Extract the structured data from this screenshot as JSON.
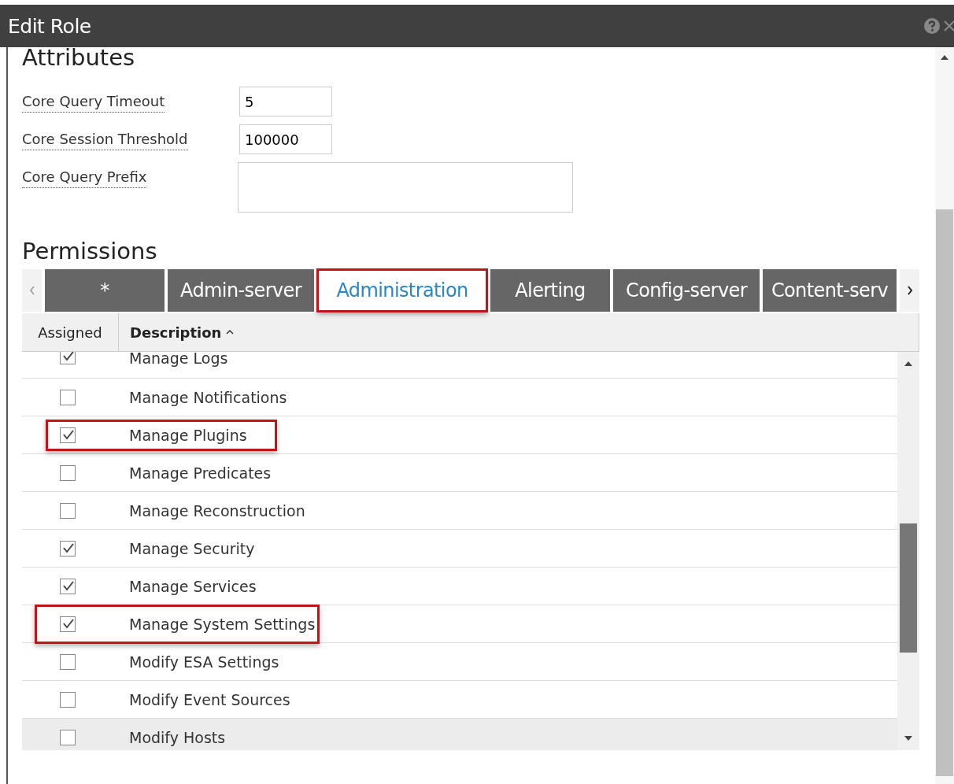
{
  "window": {
    "title": "Edit Role"
  },
  "attributes": {
    "heading": "Attributes",
    "fields": [
      {
        "label": "Core Query Timeout",
        "value": "5",
        "kind": "short"
      },
      {
        "label": "Core Session Threshold",
        "value": "100000",
        "kind": "short"
      },
      {
        "label": "Core Query Prefix",
        "kind": "area"
      }
    ]
  },
  "permissions": {
    "heading": "Permissions",
    "tabs": [
      {
        "label": "*",
        "selected": false,
        "highlighted": false
      },
      {
        "label": "Admin-server",
        "selected": false,
        "highlighted": false
      },
      {
        "label": "Administration",
        "selected": true,
        "highlighted": true
      },
      {
        "label": "Alerting",
        "selected": false,
        "highlighted": false
      },
      {
        "label": "Config-server",
        "selected": false,
        "highlighted": false
      },
      {
        "label": "Content-serv",
        "selected": false,
        "highlighted": false
      }
    ],
    "columns": [
      "Assigned",
      "Description"
    ],
    "rows": [
      {
        "description": "Manage Logs",
        "checked": true,
        "highlighted": false,
        "hovered": false
      },
      {
        "description": "Manage Notifications",
        "checked": false,
        "highlighted": false,
        "hovered": false
      },
      {
        "description": "Manage Plugins",
        "checked": true,
        "highlighted": true,
        "hovered": false
      },
      {
        "description": "Manage Predicates",
        "checked": false,
        "highlighted": false,
        "hovered": false
      },
      {
        "description": "Manage Reconstruction",
        "checked": false,
        "highlighted": false,
        "hovered": false
      },
      {
        "description": "Manage Security",
        "checked": true,
        "highlighted": false,
        "hovered": false
      },
      {
        "description": "Manage Services",
        "checked": true,
        "highlighted": false,
        "hovered": false
      },
      {
        "description": "Manage System Settings",
        "checked": true,
        "highlighted": true,
        "hovered": false
      },
      {
        "description": "Modify ESA Settings",
        "checked": false,
        "highlighted": false,
        "hovered": false
      },
      {
        "description": "Modify Event Sources",
        "checked": false,
        "highlighted": false,
        "hovered": false
      },
      {
        "description": "Modify Hosts",
        "checked": false,
        "highlighted": false,
        "hovered": true
      }
    ]
  }
}
